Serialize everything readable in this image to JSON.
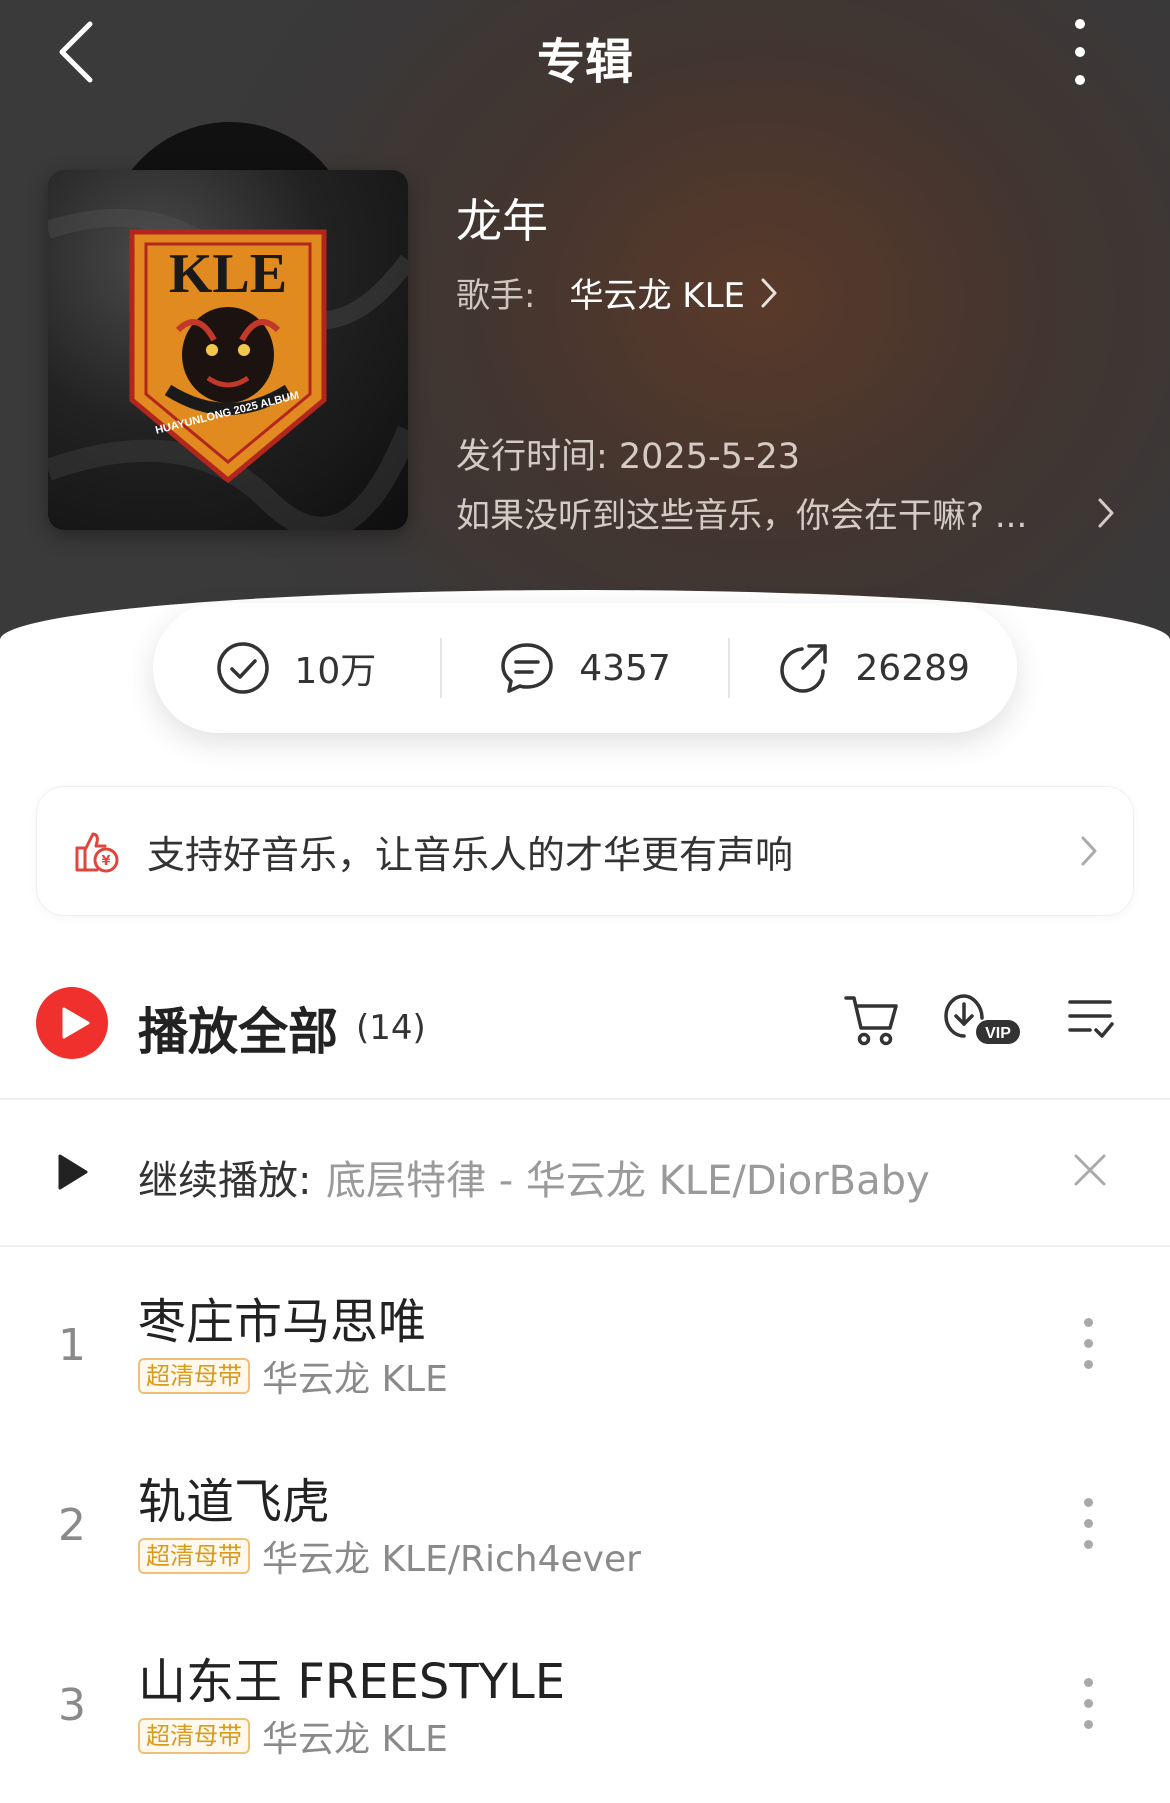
{
  "header": {
    "title": "专辑"
  },
  "album": {
    "name": "龙年",
    "singer_label": "歌手:",
    "singer_name": "华云龙 KLE",
    "release": "发行时间: 2025-5-23",
    "description": "如果没听到这些音乐，你会在干嘛? ...",
    "cover_lettering": "KLE",
    "cover_subtext": "HUAYUNLONG 2025 ALBUM"
  },
  "stats": {
    "collect": "10万",
    "comments": "4357",
    "shares": "26289"
  },
  "support": {
    "text": "支持好音乐，让音乐人的才华更有声响"
  },
  "playall": {
    "label": "播放全部",
    "count": "(14)"
  },
  "continue": {
    "label": "继续播放:",
    "track": "底层特律 - 华云龙 KLE/DiorBaby"
  },
  "tracks": [
    {
      "num": "1",
      "title": "枣庄市马思唯",
      "badge": "超清母带",
      "artist": "华云龙 KLE"
    },
    {
      "num": "2",
      "title": "轨道飞虎",
      "badge": "超清母带",
      "artist": "华云龙 KLE/Rich4ever"
    },
    {
      "num": "3",
      "title": "山东王 FREESTYLE",
      "badge": "超清母带",
      "artist": "华云龙 KLE"
    }
  ],
  "colors": {
    "accent_red": "#f0302c",
    "badge_gold": "#d99a1e"
  },
  "icons": [
    "back-icon",
    "more-icon",
    "check-circle-icon",
    "comment-icon",
    "share-icon",
    "thumbs-up-coin-icon",
    "chevron-right-icon",
    "play-icon",
    "cart-icon",
    "download-vip-icon",
    "multi-select-icon",
    "close-icon"
  ]
}
